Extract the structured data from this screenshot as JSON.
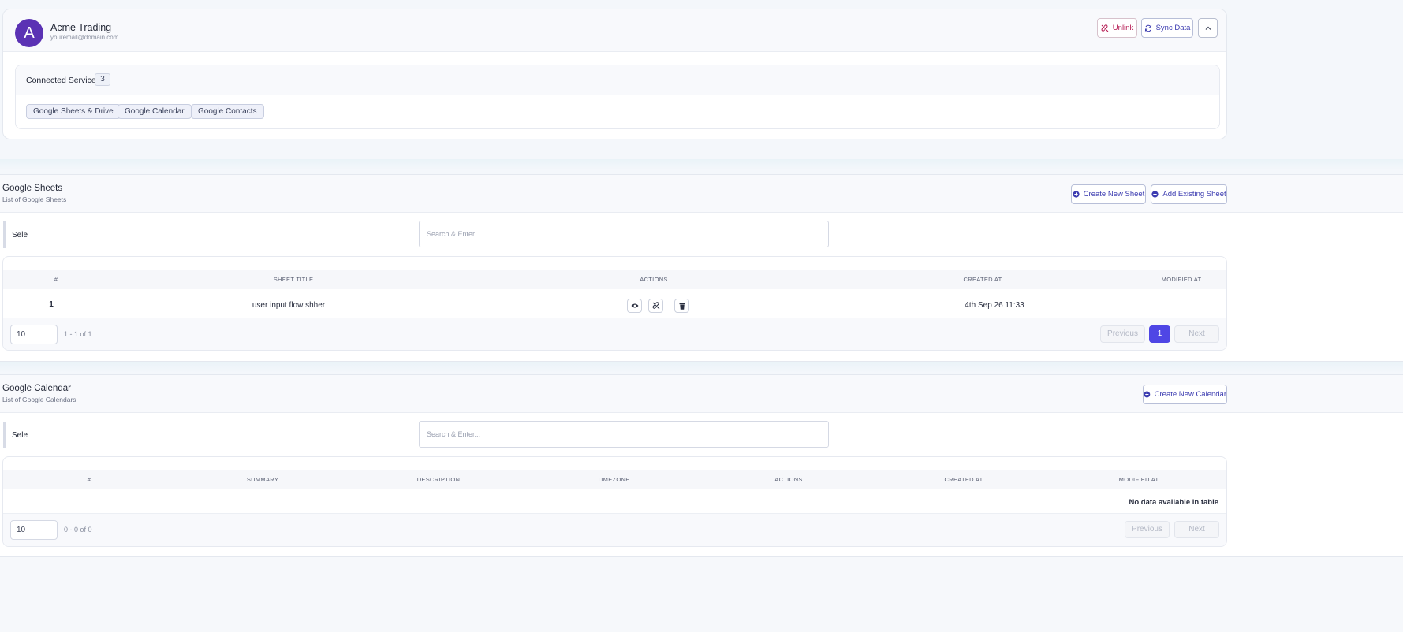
{
  "account": {
    "avatar_letter": "A",
    "name": "Acme Trading",
    "email": "youremail@domain.com",
    "unlink_label": "Unlink",
    "sync_label": "Sync Data"
  },
  "services": {
    "title": "Connected Services",
    "count": "3",
    "items": [
      "Google Sheets & Drive",
      "Google Calendar",
      "Google Contacts"
    ]
  },
  "sheets": {
    "title": "Google Sheets",
    "subtitle": "List of Google Sheets",
    "create_label": "Create New Sheet",
    "add_existing_label": "Add Existing Sheet",
    "select_label": "Sele",
    "search_placeholder": "Search & Enter...",
    "columns": [
      "#",
      "SHEET TITLE",
      "ACTIONS",
      "CREATED AT",
      "MODIFIED AT"
    ],
    "rows": [
      {
        "index": "1",
        "title": "user input flow shher",
        "created_at": "4th Sep 26 11:33",
        "modified_at": ""
      }
    ],
    "page_size": "10",
    "range_text": "1 - 1 of 1",
    "prev_label": "Previous",
    "next_label": "Next",
    "current_page": "1"
  },
  "calendar": {
    "title": "Google Calendar",
    "subtitle": "List of Google Calendars",
    "create_label": "Create New Calendar",
    "select_label": "Sele",
    "search_placeholder": "Search & Enter...",
    "columns": [
      "#",
      "SUMMARY",
      "DESCRIPTION",
      "TIMEZONE",
      "ACTIONS",
      "CREATED AT",
      "MODIFIED AT"
    ],
    "empty_text": "No data available in table",
    "page_size": "10",
    "range_text": "0 - 0 of 0",
    "prev_label": "Previous",
    "next_label": "Next"
  },
  "colors": {
    "accent": "#4f46e5",
    "avatar": "#5b32b4",
    "unlink": "#b4164f"
  },
  "icons": {
    "unlink": "link-off-icon",
    "sync": "refresh-icon",
    "collapse": "chevron-up-icon",
    "create": "plus-circle-icon",
    "view": "eye-icon",
    "detach": "link-off-icon",
    "delete": "trash-icon"
  }
}
